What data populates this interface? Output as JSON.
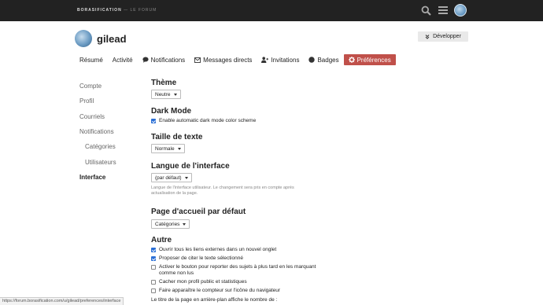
{
  "header": {
    "brand": "BORASIFICATION",
    "brand_separator": "—",
    "brand_sub": "LE FORUM",
    "icons": [
      "search-icon",
      "hamburger-menu-icon",
      "user-avatar"
    ]
  },
  "user": {
    "name": "gilead",
    "expand_label": "Développer"
  },
  "tabs": [
    {
      "label": "Résumé",
      "icon": null
    },
    {
      "label": "Activité",
      "icon": null
    },
    {
      "label": "Notifications",
      "icon": "chat-bubble-icon"
    },
    {
      "label": "Messages directs",
      "icon": "envelope-icon"
    },
    {
      "label": "Invitations",
      "icon": "user-plus-icon"
    },
    {
      "label": "Badges",
      "icon": "badge-icon"
    },
    {
      "label": "Préférences",
      "icon": "gear-icon",
      "active": true
    }
  ],
  "sidebar": {
    "items": [
      {
        "label": "Compte"
      },
      {
        "label": "Profil"
      },
      {
        "label": "Courriels"
      },
      {
        "label": "Notifications"
      },
      {
        "label": "Catégories",
        "sub": true
      },
      {
        "label": "Utilisateurs",
        "sub": true
      },
      {
        "label": "Interface",
        "active": true
      }
    ]
  },
  "prefs": {
    "theme": {
      "title": "Thème",
      "value": "Neutre"
    },
    "dark_mode": {
      "title": "Dark Mode",
      "option": "Enable automatic dark mode color scheme",
      "checked": true
    },
    "text_size": {
      "title": "Taille de texte",
      "value": "Normale"
    },
    "language": {
      "title": "Langue de l'interface",
      "value": "(par défaut)",
      "help_line1": "Langue de l'interface utilisateur. Le changement sera pris en compte après",
      "help_line2": "actualisation de la page."
    },
    "homepage": {
      "title": "Page d'accueil par défaut",
      "value": "Catégories"
    },
    "other": {
      "title": "Autre",
      "options": [
        {
          "label": "Ouvrir tous les liens externes dans un nouvel onglet",
          "checked": true
        },
        {
          "label": "Proposer de citer le texte sélectionné",
          "checked": true
        },
        {
          "label": "Activer le bouton pour reporter des sujets à plus tard en les marquant",
          "label2": "comme non lus",
          "checked": false
        },
        {
          "label": "Cacher mon profil public et statistiques",
          "checked": false
        },
        {
          "label": "Faire apparaître le compteur sur l'icône du navigateur",
          "checked": false
        }
      ],
      "title_count_text": "Le titre de la page en arrière-plan affiche le nombre de :"
    }
  },
  "status_bar": "https://forum.borasification.com/u/gilead/preferences/interface",
  "colors": {
    "topbar": "#222222",
    "active_tab": "#c0504a",
    "checkbox": "#2a6fd6"
  }
}
